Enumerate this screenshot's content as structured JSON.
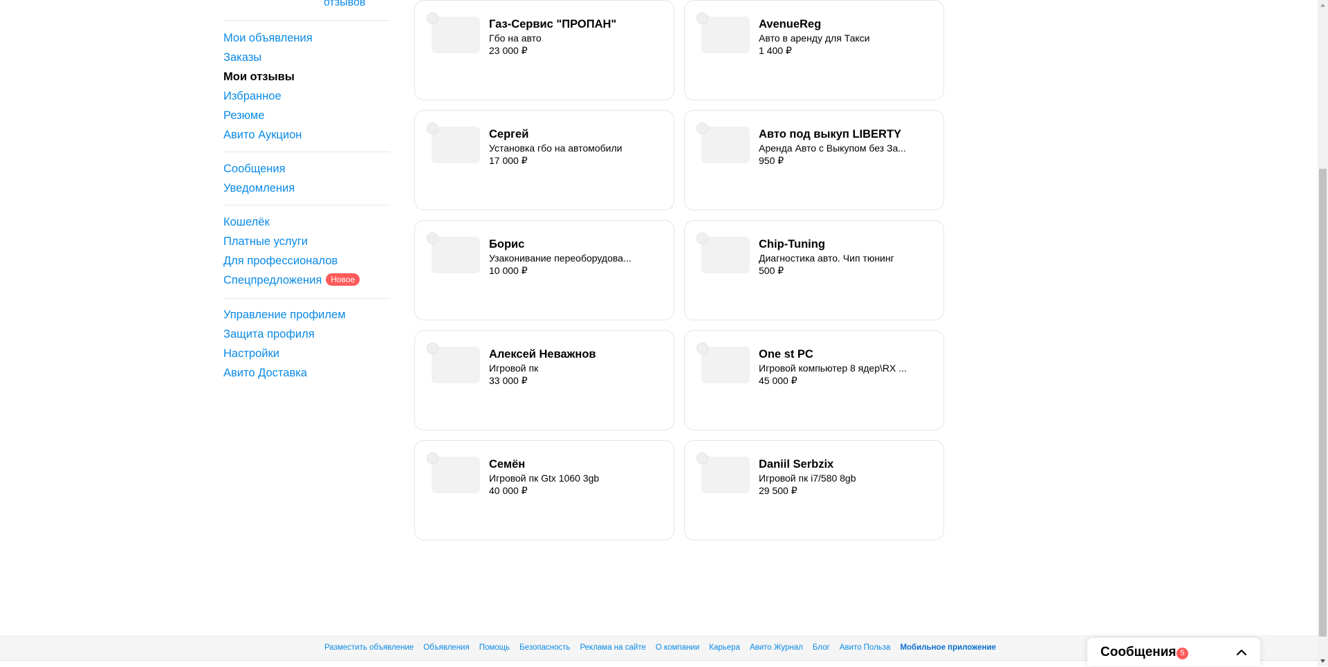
{
  "sidebar": {
    "top_link": "отзывов",
    "groups": [
      [
        "Мои объявления",
        "Заказы",
        "Мои отзывы",
        "Избранное",
        "Резюме",
        "Авито Аукцион"
      ],
      [
        "Сообщения",
        "Уведомления"
      ],
      [
        "Кошелёк",
        "Платные услуги",
        "Для профессионалов",
        "Спецпредложения"
      ],
      [
        "Управление профилем",
        "Защита профиля",
        "Настройки",
        "Авито Доставка"
      ]
    ],
    "active_item": "Мои отзывы",
    "badge_new": "Новое"
  },
  "cards": [
    {
      "name": "Газ-Сервис \"ПРОПАН\"",
      "desc": "Гбо на авто",
      "price": "23 000 ₽"
    },
    {
      "name": "AvenueReg",
      "desc": "Авто в аренду для Такси",
      "price": "1 400 ₽"
    },
    {
      "name": "Сергей",
      "desc": "Установка гбо на автомобили",
      "price": "17 000 ₽"
    },
    {
      "name": "Авто под выкуп LIBERTY",
      "desc": "Аренда Авто с Выкупом без За...",
      "price": "950 ₽"
    },
    {
      "name": "Борис",
      "desc": "Узаконивание переоборудова...",
      "price": "10 000 ₽"
    },
    {
      "name": "Chip-Tuning",
      "desc": "Диагностика авто. Чип тюнинг",
      "price": "500 ₽"
    },
    {
      "name": "Алексей Неважнов",
      "desc": "Игровой пк",
      "price": "33 000 ₽"
    },
    {
      "name": "One st PC",
      "desc": "Игровой компьютер 8 ядер\\RX ...",
      "price": "45 000 ₽"
    },
    {
      "name": "Семён",
      "desc": "Игровой пк Gtx 1060 3gb",
      "price": "40 000 ₽"
    },
    {
      "name": "Daniil Serbzix",
      "desc": "Игровой пк i7/580 8gb",
      "price": "29 500 ₽"
    }
  ],
  "footer": {
    "links": [
      "Разместить объявление",
      "Объявления",
      "Помощь",
      "Безопасность",
      "Реклама на сайте",
      "О компании",
      "Карьера",
      "Авито Журнал",
      "Блог",
      "Авито Польза",
      "Мобильное приложение"
    ]
  },
  "messages_widget": {
    "title": "Сообщения",
    "count": "5"
  },
  "colors": {
    "link": "#0a8ae6",
    "badge": "#ff5a5a"
  }
}
